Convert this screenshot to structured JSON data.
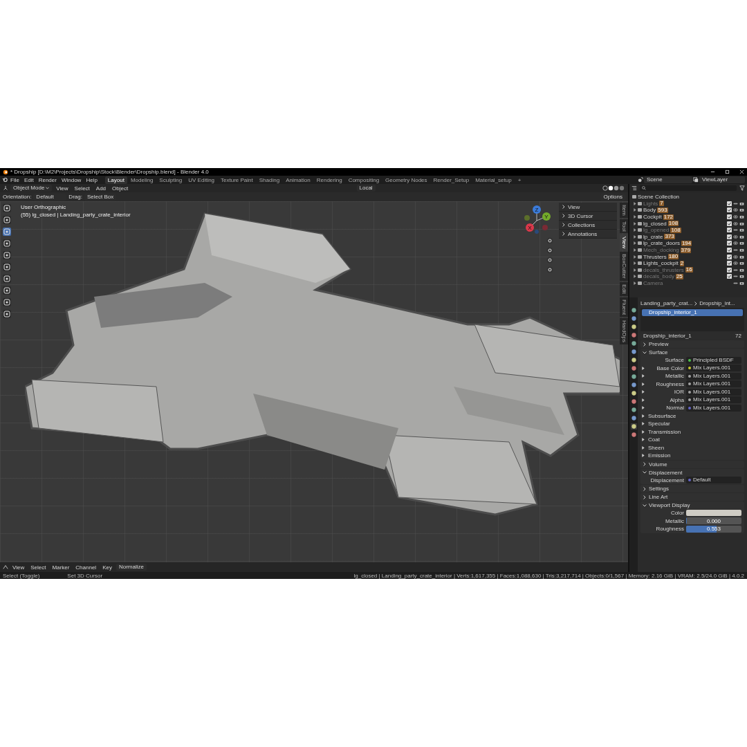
{
  "window": {
    "title": "* Dropship [D:\\M2\\Projects\\Dropship\\Stock\\Blender\\Dropship.blend] - Blender 4.0"
  },
  "menu": [
    "File",
    "Edit",
    "Render",
    "Window",
    "Help"
  ],
  "workspaces": [
    {
      "label": "Layout",
      "selected": true
    },
    {
      "label": "Modeling",
      "selected": false
    },
    {
      "label": "Sculpting",
      "selected": false
    },
    {
      "label": "UV Editing",
      "selected": false
    },
    {
      "label": "Texture Paint",
      "selected": false
    },
    {
      "label": "Shading",
      "selected": false
    },
    {
      "label": "Animation",
      "selected": false
    },
    {
      "label": "Rendering",
      "selected": false
    },
    {
      "label": "Compositing",
      "selected": false
    },
    {
      "label": "Geometry Nodes",
      "selected": false
    },
    {
      "label": "Render_Setup",
      "selected": false
    },
    {
      "label": "Material_setup",
      "selected": false
    }
  ],
  "add_workspace": "+",
  "scene": {
    "name": "Scene"
  },
  "view_layer": {
    "name": "ViewLayer"
  },
  "viewport_header": {
    "mode": "Object Mode",
    "menus": [
      "View",
      "Select",
      "Add",
      "Object"
    ],
    "transform_space": "Local",
    "options": "Options"
  },
  "tool_settings": {
    "orientation_label": "Orientation:",
    "orientation": "Default",
    "drag_label": "Drag:",
    "drag": "Select Box"
  },
  "viewport": {
    "view_name": "User Orthographic",
    "info": "(55) lg_closed | Landing_party_crate_interior"
  },
  "gizmo_axes": [
    {
      "label": "Z",
      "color": "#3b7bd9"
    },
    {
      "label": "Y",
      "color": "#74ab2a"
    },
    {
      "label": "X",
      "color": "#d9384a"
    }
  ],
  "sidebar_panels": [
    "View",
    "3D Cursor",
    "Collections",
    "Annotations"
  ],
  "sidebar_tabs": [
    {
      "label": "Item",
      "selected": false
    },
    {
      "label": "Tool",
      "selected": false
    },
    {
      "label": "View",
      "selected": true
    },
    {
      "label": "BoxCutter",
      "selected": false
    },
    {
      "label": "Edit",
      "selected": false
    },
    {
      "label": "Fluent",
      "selected": false
    },
    {
      "label": "HardOps",
      "selected": false
    }
  ],
  "outliner": {
    "root": "Scene Collection",
    "items": [
      {
        "name": "Lights",
        "count": "7",
        "included": true,
        "hidden": true
      },
      {
        "name": "Body",
        "count": "593",
        "included": true,
        "hidden": false
      },
      {
        "name": "Cockpit",
        "count": "172",
        "included": true,
        "hidden": false
      },
      {
        "name": "lg_closed",
        "count": "108",
        "included": true,
        "hidden": false
      },
      {
        "name": "lg_opened",
        "count": "108",
        "included": true,
        "hidden": true
      },
      {
        "name": "lp_crate",
        "count": "373",
        "included": true,
        "hidden": false
      },
      {
        "name": "lp_crate_doors",
        "count": "194",
        "included": true,
        "hidden": false
      },
      {
        "name": "Mech_docking",
        "count": "379",
        "included": true,
        "hidden": true
      },
      {
        "name": "Thrusters",
        "count": "180",
        "included": true,
        "hidden": false
      },
      {
        "name": "Lights_cockpit",
        "count": "2",
        "included": true,
        "hidden": false
      },
      {
        "name": "decals_thrusters",
        "count": "16",
        "included": true,
        "hidden": true
      },
      {
        "name": "decals_body",
        "count": "25",
        "included": true,
        "hidden": true
      },
      {
        "name": "Camera",
        "included": false,
        "hidden": true
      }
    ]
  },
  "properties": {
    "breadcrumb": [
      "Landing_party_crat...",
      "Dropship_int..."
    ],
    "slots": [
      {
        "name": "Dropship_interior_1",
        "selected": true
      }
    ],
    "material": {
      "name": "Dropship_interior_1",
      "users": "72"
    },
    "sections": [
      {
        "title": "Preview",
        "expanded": false
      },
      {
        "title": "Surface",
        "expanded": true,
        "rows": [
          {
            "kind": "socket",
            "label": "Surface",
            "value": "Principled BSDF",
            "color": "#4cc24c",
            "expandable": false
          },
          {
            "kind": "socket",
            "label": "Base Color",
            "value": "Mix Layers.001",
            "color": "#c7c729",
            "expandable": true
          },
          {
            "kind": "socket",
            "label": "Metallic",
            "value": "Mix Layers.001",
            "color": "#a1a1a1",
            "expandable": true
          },
          {
            "kind": "socket",
            "label": "Roughness",
            "value": "Mix Layers.001",
            "color": "#a1a1a1",
            "expandable": true
          },
          {
            "kind": "socket",
            "label": "IOR",
            "value": "Mix Layers.001",
            "color": "#a1a1a1",
            "expandable": true
          },
          {
            "kind": "socket",
            "label": "Alpha",
            "value": "Mix Layers.001",
            "color": "#a1a1a1",
            "expandable": true
          },
          {
            "kind": "socket",
            "label": "Normal",
            "value": "Mix Layers.001",
            "color": "#6363c7",
            "expandable": true
          },
          {
            "kind": "subpanel",
            "label": "Subsurface"
          },
          {
            "kind": "subpanel",
            "label": "Specular"
          },
          {
            "kind": "subpanel",
            "label": "Transmission"
          },
          {
            "kind": "subpanel",
            "label": "Coat"
          },
          {
            "kind": "subpanel",
            "label": "Sheen"
          },
          {
            "kind": "subpanel",
            "label": "Emission"
          }
        ]
      },
      {
        "title": "Volume",
        "expanded": false
      },
      {
        "title": "Displacement",
        "expanded": true,
        "rows": [
          {
            "kind": "socket",
            "label": "Displacement",
            "value": "Default",
            "color": "#6363c7",
            "expandable": false
          }
        ]
      },
      {
        "title": "Settings",
        "expanded": false
      },
      {
        "title": "Line Art",
        "expanded": false
      },
      {
        "title": "Viewport Display",
        "expanded": true,
        "rows": [
          {
            "kind": "color",
            "label": "Color",
            "color": "#cfccc4"
          },
          {
            "kind": "slider",
            "label": "Metallic",
            "value": "0.000",
            "level": 0
          },
          {
            "kind": "slider",
            "label": "Roughness",
            "value": "0.553",
            "level": 0.553
          }
        ]
      }
    ]
  },
  "timeline": {
    "menus": [
      "View",
      "Select",
      "Marker",
      "Channel",
      "Key"
    ],
    "normalize": "Normalize"
  },
  "status_bar": {
    "hints": [
      "Select (Toggle)",
      "Set 3D Cursor"
    ],
    "stats": "lg_closed | Landing_party_crate_interior | Verts:1,617,355 | Faces:1,088,630 | Tris:3,217,714 | Objects:0/1,567 | Memory: 2.16 GiB | VRAM: 2.5/24.0 GiB | 4.0.2"
  }
}
